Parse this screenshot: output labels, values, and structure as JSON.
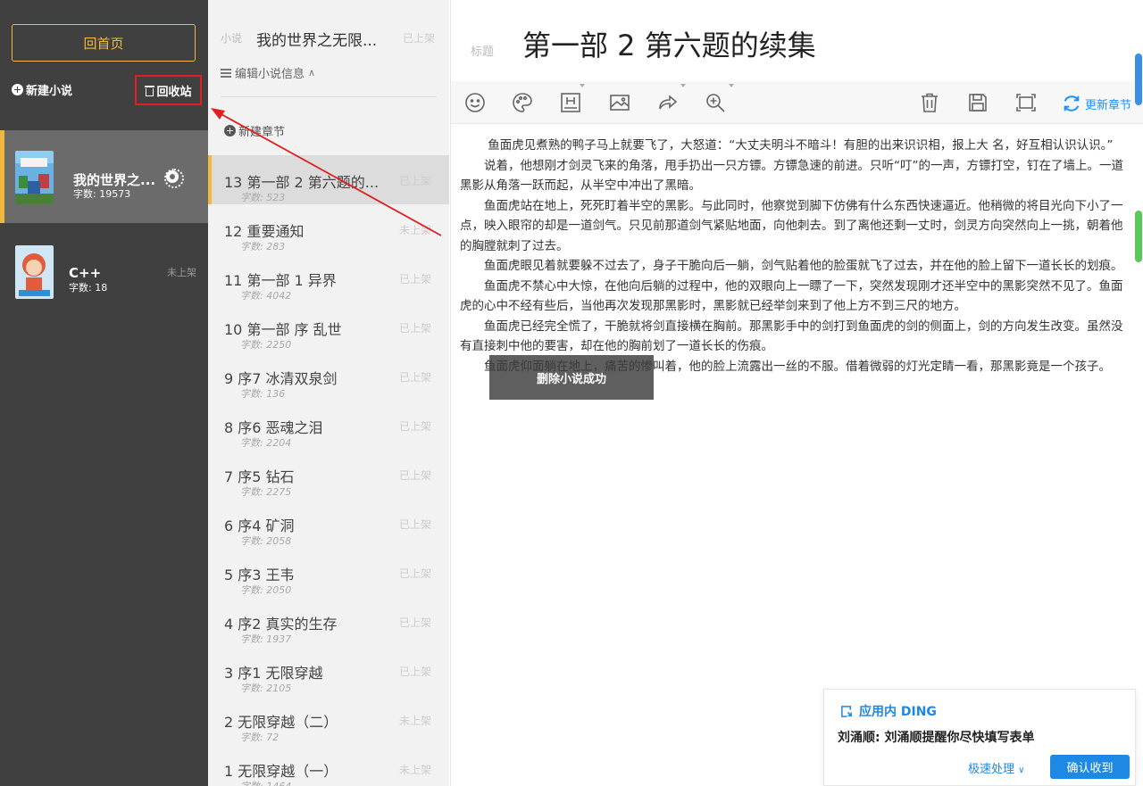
{
  "sidebar": {
    "home_label": "回首页",
    "new_novel_label": "新建小说",
    "recycle_label": "回收站",
    "novels": [
      {
        "title": "我的世界之...",
        "word_count": "字数: 19573",
        "status": ""
      },
      {
        "title": "C++",
        "word_count": "字数: 18",
        "status": "未上架"
      }
    ]
  },
  "chapter_panel": {
    "novel_label": "小说",
    "novel_name": "我的世界之无限...",
    "novel_status": "已上架",
    "edit_info_label": "编辑小说信息",
    "new_chapter_label": "新建章节",
    "chapters": [
      {
        "title": "13  第一部 2 第六题的...",
        "words": "字数: 523",
        "status": "已上架"
      },
      {
        "title": "12  重要通知",
        "words": "字数: 283",
        "status": "未上架"
      },
      {
        "title": "11  第一部 1 异界",
        "words": "字数: 4042",
        "status": "已上架"
      },
      {
        "title": "10  第一部 序 乱世",
        "words": "字数: 2250",
        "status": "已上架"
      },
      {
        "title": "9  序7 冰清双泉剑",
        "words": "字数: 136",
        "status": "已上架"
      },
      {
        "title": "8  序6 恶魂之泪",
        "words": "字数: 2204",
        "status": "已上架"
      },
      {
        "title": "7  序5 钻石",
        "words": "字数: 2275",
        "status": "已上架"
      },
      {
        "title": "6  序4 矿洞",
        "words": "字数: 2058",
        "status": "已上架"
      },
      {
        "title": "5  序3 王韦",
        "words": "字数: 2050",
        "status": "已上架"
      },
      {
        "title": "4  序2 真实的生存",
        "words": "字数: 1937",
        "status": "已上架"
      },
      {
        "title": "3  序1 无限穿越",
        "words": "字数: 2105",
        "status": "已上架"
      },
      {
        "title": "2  无限穿越（二）",
        "words": "字数: 72",
        "status": "未上架"
      },
      {
        "title": "1  无限穿越（一）",
        "words": "字数: 1464",
        "status": "未上架"
      }
    ]
  },
  "editor": {
    "title_label": "标题",
    "chapter_title": "第一部 2 第六题的续集",
    "update_label": "更新章节",
    "paragraphs": [
      "　　 鱼面虎见煮熟的鸭子马上就要飞了，大怒道：“大丈夫明斗不暗斗！有胆的出来识识相，报上大 名，好互相认识认识。”",
      "说着，他想刚才剑灵飞来的角落，甩手扔出一只方镖。方镖急速的前进。只听“叮”的一声，方镖打空，钉在了墙上。一道黑影从角落一跃而起，从半空中冲出了黑暗。",
      "鱼面虎站在地上，死死盯着半空的黑影。与此同时，他察觉到脚下仿佛有什么东西快速逼近。他稍微的将目光向下小了一点，映入眼帘的却是一道剑气。只见前那道剑气紧贴地面，向他刺去。到了离他还剩一丈时，剑灵方向突然向上一挑，朝着他的胸膛就刺了过去。",
      "鱼面虎眼见着就要躲不过去了，身子干脆向后一躺，剑气贴着他的脸蛋就飞了过去，并在他的脸上留下一道长长的划痕。",
      "鱼面虎不禁心中大惊，在他向后躺的过程中，他的双眼向上一瞟了一下，突然发现刚才还半空中的黑影突然不见了。鱼面虎的心中不经有些后，当他再次发现那黑影时，黑影就已经举剑来到了他上方不到三尺的地方。",
      "鱼面虎已经完全慌了，干脆就将剑直接横在胸前。那黑影手中的剑打到鱼面虎的剑的侧面上，剑的方向发生改变。虽然没有直接刺中他的要害，却在他的胸前划了一道长长的伤痕。",
      "鱼面虎仰面躺在地上，痛苦的惨叫着，他的脸上流露出一丝的不服。借着微弱的灯光定睛一看，那黑影竟是一个孩子。"
    ]
  },
  "toast": {
    "message": "删除小说成功"
  },
  "ding": {
    "header": "应用内 DING",
    "message": "刘涌顺: 刘涌顺提醒你尽快填写表单",
    "quick_label": "极速处理",
    "confirm_label": "确认收到"
  },
  "colors": {
    "accent": "#f0b93d",
    "sidebar_bg": "#404040",
    "link_blue": "#1e88e5",
    "highlight_red": "#e02020"
  }
}
